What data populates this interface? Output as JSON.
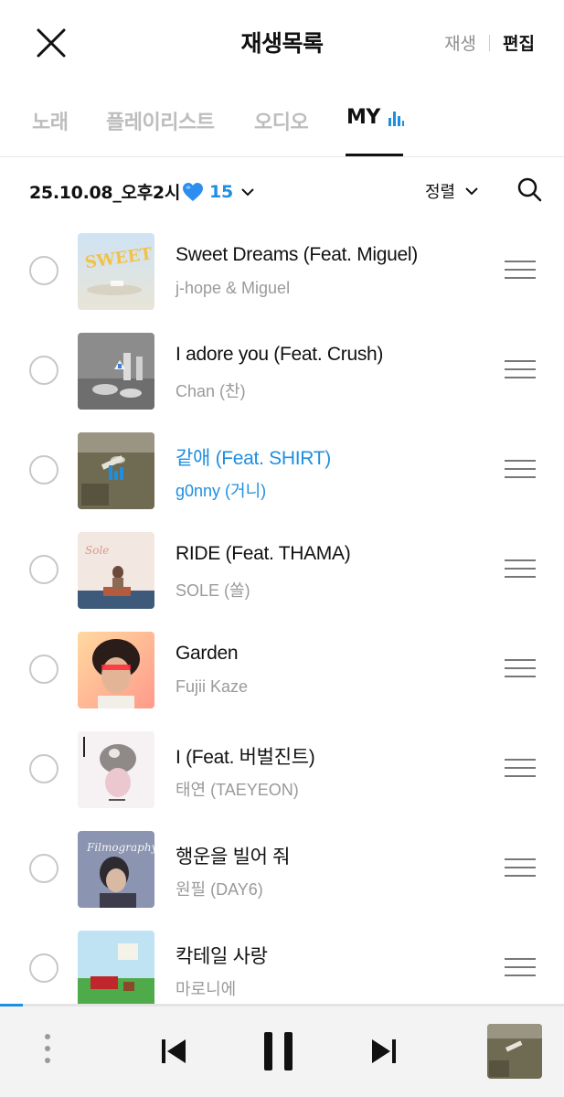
{
  "header": {
    "title": "재생목록",
    "play_label": "재생",
    "edit_label": "편집"
  },
  "tabs": [
    {
      "label": "노래",
      "active": false
    },
    {
      "label": "플레이리스트",
      "active": false
    },
    {
      "label": "오디오",
      "active": false
    },
    {
      "label": "MY",
      "active": true,
      "icon": "equalizer-icon"
    }
  ],
  "toolbar": {
    "playlist_name": "25.10.08_오후2시",
    "emoji": "blue-heart",
    "count": "15",
    "sort_label": "정렬"
  },
  "songs": [
    {
      "title": "Sweet Dreams (Feat. Miguel)",
      "artist": "j-hope & Miguel",
      "playing": false
    },
    {
      "title": "I adore you (Feat. Crush)",
      "artist": "Chan (찬)",
      "playing": false
    },
    {
      "title": "같애 (Feat. SHIRT)",
      "artist": "g0nny (거니)",
      "playing": true
    },
    {
      "title": "RIDE (Feat. THAMA)",
      "artist": "SOLE (쏠)",
      "playing": false
    },
    {
      "title": "Garden",
      "artist": "Fujii Kaze",
      "playing": false
    },
    {
      "title": "I (Feat. 버벌진트)",
      "artist": "태연 (TAEYEON)",
      "playing": false
    },
    {
      "title": "행운을 빌어 줘",
      "artist": "원필 (DAY6)",
      "playing": false
    },
    {
      "title": "칵테일 사랑",
      "artist": "마로니에",
      "playing": false
    }
  ],
  "album_art_text": {
    "sweet_dreams": "SWEET DREAMS",
    "sole": "Sole",
    "filmography": "Filmography"
  },
  "colors": {
    "accent": "#1e8fe0",
    "text": "#111111",
    "muted": "#9a9a9a",
    "inactive_tab": "#bdbdbd",
    "player_bg": "#f3f3f3"
  },
  "player": {
    "progress_fraction": 0.04,
    "state": "playing"
  }
}
